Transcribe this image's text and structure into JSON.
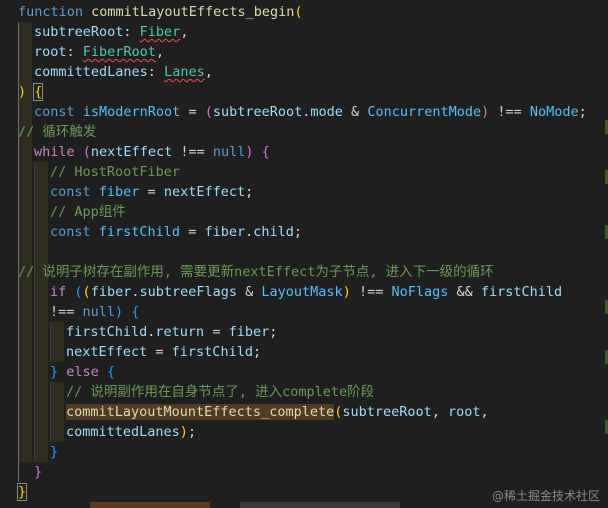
{
  "code": {
    "l1_fn": "function",
    "l1_name": "commitLayoutEffects_begin",
    "l2_param": "subtreeRoot",
    "l2_type": "Fiber",
    "l3_param": "root",
    "l3_type": "FiberRoot",
    "l4_param": "committedLanes",
    "l4_type": "Lanes",
    "l6_const": "const",
    "l6_var": "isModernRoot",
    "l6_obj": "subtreeRoot",
    "l6_prop": "mode",
    "l6_cm": "ConcurrentMode",
    "l6_nomode": "NoMode",
    "l7_comment": "// 循环触发",
    "l8_while": "while",
    "l8_var": "nextEffect",
    "l8_null": "null",
    "l9_comment": "// HostRootFiber",
    "l10_const": "const",
    "l10_var": "fiber",
    "l10_val": "nextEffect",
    "l11_comment": "// App组件",
    "l12_const": "const",
    "l12_var": "firstChild",
    "l12_obj": "fiber",
    "l12_prop": "child",
    "l14_comment": "// 说明子树存在副作用, 需要更新nextEffect为子节点, 进入下一级的循环",
    "l15_if": "if",
    "l15_obj": "fiber",
    "l15_prop": "subtreeFlags",
    "l15_mask": "LayoutMask",
    "l15_noflags": "NoFlags",
    "l15_child": "firstChild",
    "l16_null": "null",
    "l17_obj": "firstChild",
    "l17_prop": "return",
    "l17_val": "fiber",
    "l18_var": "nextEffect",
    "l18_val": "firstChild",
    "l19_else": "else",
    "l20_comment": "// 说明副作用在自身节点了, 进入complete阶段",
    "l21_fn": "commitLayoutMountEffects_complete",
    "l21_a1": "subtreeRoot",
    "l21_a2": "root",
    "l22_a3": "committedLanes"
  },
  "watermark": "@稀土掘金技术社区",
  "colors": {
    "background": "#1f1f1f",
    "keyword": "#569cd6",
    "control": "#c586c0",
    "function": "#dcdcaa",
    "variable": "#9cdcfe",
    "type": "#4ec9b0",
    "constant": "#4fc1ff",
    "comment": "#6a9955"
  }
}
